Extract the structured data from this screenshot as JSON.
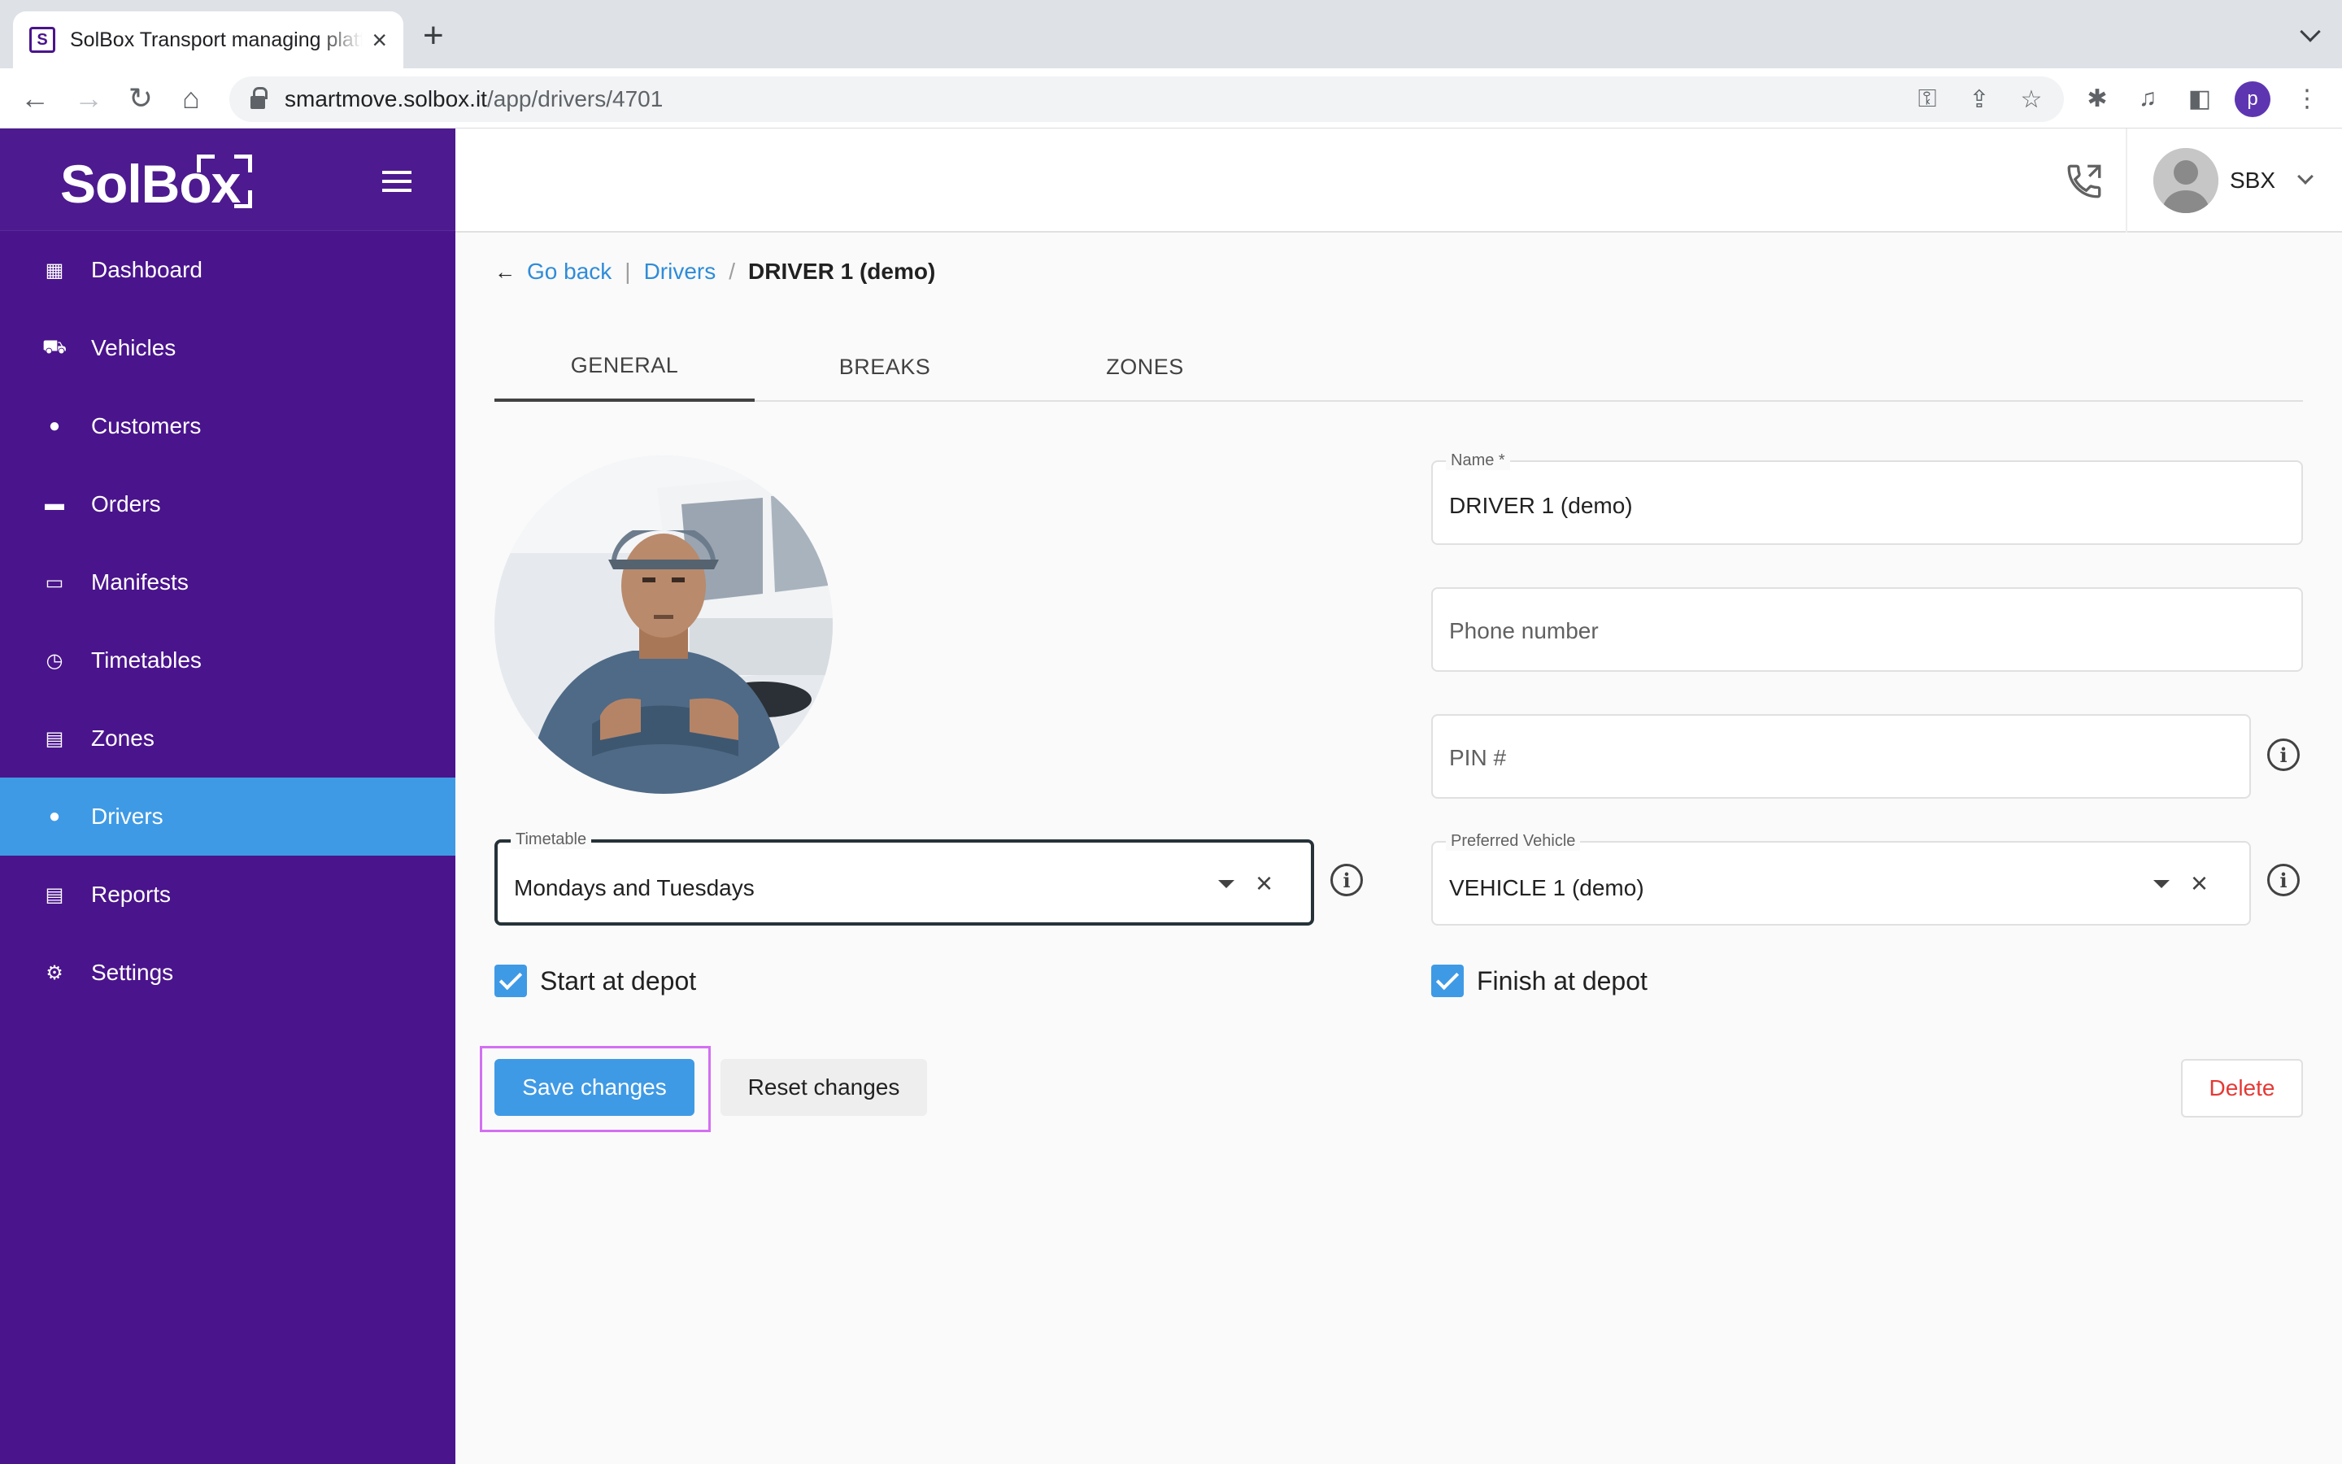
{
  "browser": {
    "tab_title": "SolBox Transport managing platform",
    "favicon_letter": "S",
    "url_host": "smartmove.solbox.it",
    "url_path": "/app/drivers/4701",
    "profile_letter": "p"
  },
  "sidebar": {
    "logo": "SolBox",
    "items": [
      {
        "label": "Dashboard",
        "icon": "dashboard-icon"
      },
      {
        "label": "Vehicles",
        "icon": "truck-icon"
      },
      {
        "label": "Customers",
        "icon": "person-icon"
      },
      {
        "label": "Orders",
        "icon": "folder-icon"
      },
      {
        "label": "Manifests",
        "icon": "manifest-icon"
      },
      {
        "label": "Timetables",
        "icon": "clock-icon"
      },
      {
        "label": "Zones",
        "icon": "zones-icon"
      },
      {
        "label": "Drivers",
        "icon": "person-icon",
        "active": true
      },
      {
        "label": "Reports",
        "icon": "report-icon"
      },
      {
        "label": "Settings",
        "icon": "gear-icon"
      }
    ],
    "active_color": "#3f9ae5",
    "bg_color": "#4a148c"
  },
  "header": {
    "user": "SBX"
  },
  "breadcrumb": {
    "back": "Go back",
    "sep1": "|",
    "drivers": "Drivers",
    "sep2": "/",
    "current": "DRIVER 1 (demo)"
  },
  "tabs": [
    {
      "label": "GENERAL",
      "active": true
    },
    {
      "label": "BREAKS",
      "active": false
    },
    {
      "label": "ZONES",
      "active": false
    }
  ],
  "form": {
    "name": {
      "label": "Name *",
      "value": "DRIVER 1 (demo)"
    },
    "phone": {
      "placeholder": "Phone number"
    },
    "pin": {
      "placeholder": "PIN #"
    },
    "timetable": {
      "label": "Timetable",
      "value": "Mondays and Tuesdays"
    },
    "preferred_vehicle": {
      "label": "Preferred Vehicle",
      "value": "VEHICLE 1 (demo)"
    },
    "start_at_depot": {
      "label": "Start at depot",
      "checked": true
    },
    "finish_at_depot": {
      "label": "Finish at depot",
      "checked": true
    }
  },
  "actions": {
    "save": "Save changes",
    "reset": "Reset changes",
    "delete": "Delete"
  }
}
